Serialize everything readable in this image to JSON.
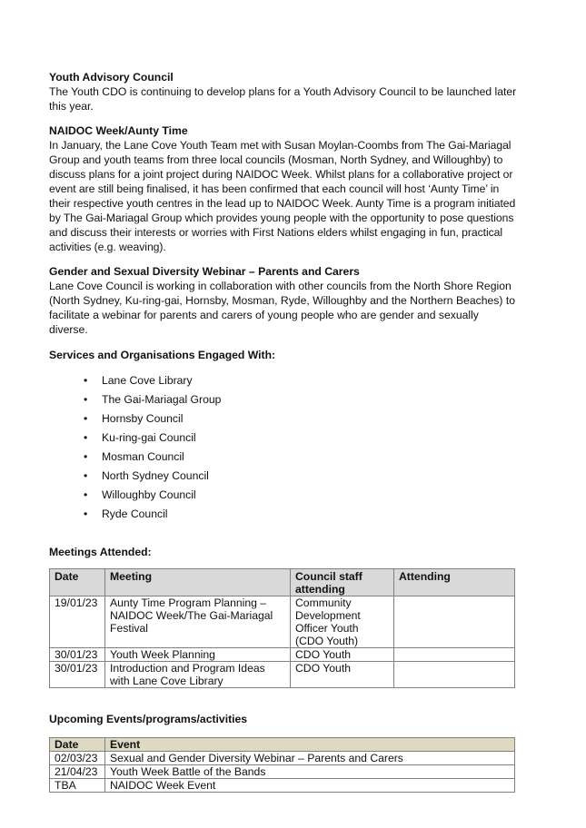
{
  "sections": [
    {
      "title": "Youth Advisory Council",
      "body": "The Youth CDO is continuing to develop plans for a Youth Advisory Council to be launched later this year."
    },
    {
      "title": "NAIDOC Week/Aunty Time",
      "body": "In January, the Lane Cove Youth Team met with Susan Moylan-Coombs from The Gai-Mariagal Group and youth teams from three local councils (Mosman, North Sydney, and Willoughby) to discuss plans for a joint project during NAIDOC Week. Whilst plans for a collaborative project or event are still being finalised, it has been confirmed that each council will host ‘Aunty Time’ in their respective youth centres in the lead up to NAIDOC Week. Aunty Time is a program initiated by The Gai-Mariagal Group which provides young people with the opportunity to pose questions and discuss their interests or worries with First Nations elders whilst engaging in fun, practical activities (e.g. weaving)."
    },
    {
      "title": "Gender and Sexual Diversity Webinar – Parents and Carers",
      "body": "Lane Cove Council is working in collaboration with other councils from the North Shore Region (North Sydney, Ku-ring-gai, Hornsby, Mosman, Ryde, Willoughby and the Northern Beaches) to facilitate a webinar for parents and carers of young people who are gender and sexually diverse."
    }
  ],
  "services": {
    "title": "Services and Organisations Engaged With:",
    "bullet": "•",
    "items": [
      "Lane Cove Library",
      "The Gai-Mariagal Group",
      "Hornsby Council",
      "Ku-ring-gai Council",
      "Mosman Council",
      "North Sydney Council",
      "Willoughby Council",
      "Ryde Council"
    ]
  },
  "meetings": {
    "title": "Meetings Attended:",
    "header_color": "#d9d9d9",
    "columns": [
      "Date",
      "Meeting",
      "Council staff attending",
      "Attending"
    ],
    "rows": [
      [
        "19/01/23",
        "Aunty Time Program Planning – NAIDOC Week/The Gai-Mariagal Festival",
        "Community Development Officer Youth (CDO Youth)",
        ""
      ],
      [
        "30/01/23",
        "Youth Week Planning",
        "CDO Youth",
        ""
      ],
      [
        "30/01/23",
        "Introduction and Program Ideas with Lane Cove Library",
        "CDO Youth",
        ""
      ]
    ]
  },
  "events": {
    "title": "Upcoming Events/programs/activities",
    "header_color": "#ddd9c3",
    "columns": [
      "Date",
      "Event"
    ],
    "rows": [
      [
        "02/03/23",
        "Sexual and Gender Diversity Webinar – Parents and Carers"
      ],
      [
        "21/04/23",
        "Youth Week Battle of the Bands"
      ],
      [
        "TBA",
        "NAIDOC Week Event"
      ]
    ]
  }
}
